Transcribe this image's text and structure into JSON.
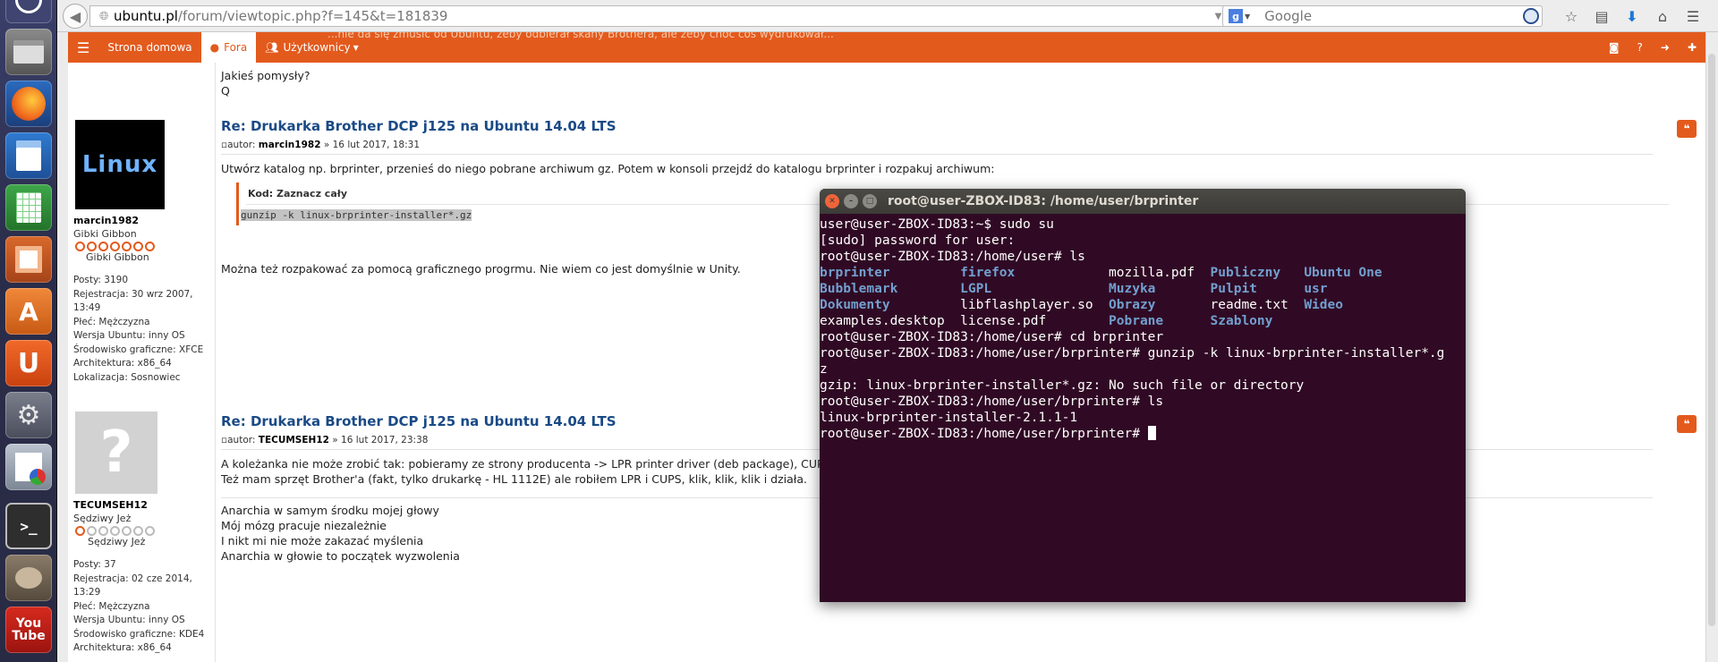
{
  "browser": {
    "url_domain": "ubuntu.pl",
    "url_path": "/forum/viewtopic.php?f=145&t=181839",
    "search_placeholder": "Google"
  },
  "launcher": {
    "icons": [
      "dash-icon",
      "files-icon",
      "firefox-icon",
      "writer-icon",
      "calc-icon",
      "impress-icon",
      "software-center-icon",
      "ubuntu-one-icon",
      "settings-icon",
      "spreadsheet-icon",
      "terminal-icon",
      "gimp-icon",
      "youtube-icon"
    ],
    "youtube_top": "You",
    "youtube_bottom": "Tube"
  },
  "nav": {
    "home": "Strona domowa",
    "forums": "Fora",
    "users": "Użytkownicy",
    "ghost_text": "...nie da się zmusić od Ubuntu, żeby odbierał skany Brothera, ale żeby choć coś wydrukował..."
  },
  "top_post": {
    "line1": "Jakieś pomysły?",
    "line2": "Q"
  },
  "post1": {
    "username": "marcin1982",
    "rank": "Gibki Gibbon",
    "rank_label": "Gibki Gibbon",
    "avatar_text": "Linux",
    "info": [
      "Posty: 3190",
      "Rejestracja: 30 wrz 2007,",
      "13:49",
      "Płeć: Mężczyzna",
      "Wersja Ubuntu: inny OS",
      "Środowisko graficzne: XFCE",
      "Architektura: x86_64",
      "Lokalizacja: Sosnowiec"
    ],
    "title": "Re: Drukarka Brother DCP j125 na Ubuntu 14.04 LTS",
    "meta_prefix": "autor:",
    "meta_author": "marcin1982",
    "meta_date": "» 16 lut 2017, 18:31",
    "body1": "Utwórz katalog np. brprinter, przenieś do niego pobrane archiwum gz. Potem w konsoli przejdź do katalogu brprinter i rozpakuj archiwum:",
    "code_label": "Kod: Zaznacz cały",
    "code": "gunzip -k linux-brprinter-installer*.gz",
    "body2": "Można też rozpakować za pomocą graficznego progrmu. Nie wiem co jest domyślnie w Unity."
  },
  "post2": {
    "username": "TECUMSEH12",
    "rank": "Sędziwy Jeż",
    "rank_label": "Sędziwy Jeż",
    "info": [
      "Posty: 37",
      "Rejestracja: 02 cze 2014,",
      "13:29",
      "Płeć: Mężczyzna",
      "Wersja Ubuntu: inny OS",
      "Środowisko graficzne: KDE4",
      "Architektura: x86_64"
    ],
    "title": "Re: Drukarka Brother DCP j125 na Ubuntu 14.04 LTS",
    "meta_prefix": "autor:",
    "meta_author": "TECUMSEH12",
    "meta_date": "» 16 lut 2017, 23:38",
    "body1": "A koleżanka nie może zrobić tak: pobieramy ze strony producenta -> LPR printer driver (deb package), CUPSwrapp",
    "body2": "Też mam sprzęt Brother'a (fakt, tylko drukarkę - HL 1112E) ale robiłem LPR i CUPS, klik, klik, klik i działa.",
    "sig": [
      "Anarchia w samym środku mojej głowy",
      "Mój mózg pracuje niezależnie",
      "I nikt mi nie może zakazać myślenia",
      "Anarchia w głowie to początek wyzwolenia"
    ]
  },
  "terminal": {
    "title": "root@user-ZBOX-ID83: /home/user/brprinter",
    "l1": "user@user-ZBOX-ID83:~$ sudo su",
    "l2": "[sudo] password for user:",
    "l3": "root@user-ZBOX-ID83:/home/user# ls",
    "ls": [
      [
        "brprinter",
        true,
        "firefox",
        true,
        "mozilla.pdf",
        false,
        "Publiczny",
        true,
        "Ubuntu One",
        true
      ],
      [
        "Bubblemark",
        true,
        "LGPL",
        true,
        "Muzyka",
        true,
        "Pulpit",
        true,
        "usr",
        true
      ],
      [
        "Dokumenty",
        true,
        "libflashplayer.so",
        false,
        "Obrazy",
        true,
        "readme.txt",
        false,
        "Wideo",
        true
      ],
      [
        "examples.desktop",
        false,
        "license.pdf",
        false,
        "Pobrane",
        true,
        "Szablony",
        true,
        "",
        false
      ]
    ],
    "l4": "root@user-ZBOX-ID83:/home/user# cd brprinter",
    "l5": "root@user-ZBOX-ID83:/home/user/brprinter# gunzip -k linux-brprinter-installer*.g",
    "l6": "z",
    "l7": "gzip: linux-brprinter-installer*.gz: No such file or directory",
    "l8": "root@user-ZBOX-ID83:/home/user/brprinter# ls",
    "l9": "linux-brprinter-installer-2.1.1-1",
    "l10": "root@user-ZBOX-ID83:/home/user/brprinter# "
  }
}
